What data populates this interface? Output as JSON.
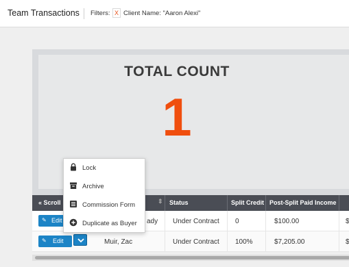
{
  "header": {
    "title": "Team Transactions",
    "filters_label": "Filters:",
    "filter_remove": "X",
    "filter_text": "Client Name: \"Aaron Alexi\""
  },
  "summary": {
    "title": "TOTAL COUNT",
    "value": "1"
  },
  "table": {
    "scroll_label": "Scroll",
    "columns": [
      "Status",
      "Split Credit",
      "Post-Split Paid Income"
    ],
    "rows": [
      {
        "edit": "Edit",
        "client": "ady",
        "status": "Under Contract",
        "split": "0",
        "income": "$100.00",
        "next": "$"
      },
      {
        "edit": "Edit",
        "client": "Muir, Zac",
        "status": "Under Contract",
        "split": "100%",
        "income": "$7,205.00",
        "next": "$"
      }
    ]
  },
  "menu": {
    "items": [
      {
        "label": "Lock",
        "icon": "lock-icon"
      },
      {
        "label": "Archive",
        "icon": "archive-icon"
      },
      {
        "label": "Commission Form",
        "icon": "form-icon"
      },
      {
        "label": "Duplicate as Buyer",
        "icon": "plus-circle-icon"
      }
    ]
  },
  "colors": {
    "accent": "#1c84c6",
    "count": "#f04e0e",
    "header_bg": "#4a4d55"
  }
}
